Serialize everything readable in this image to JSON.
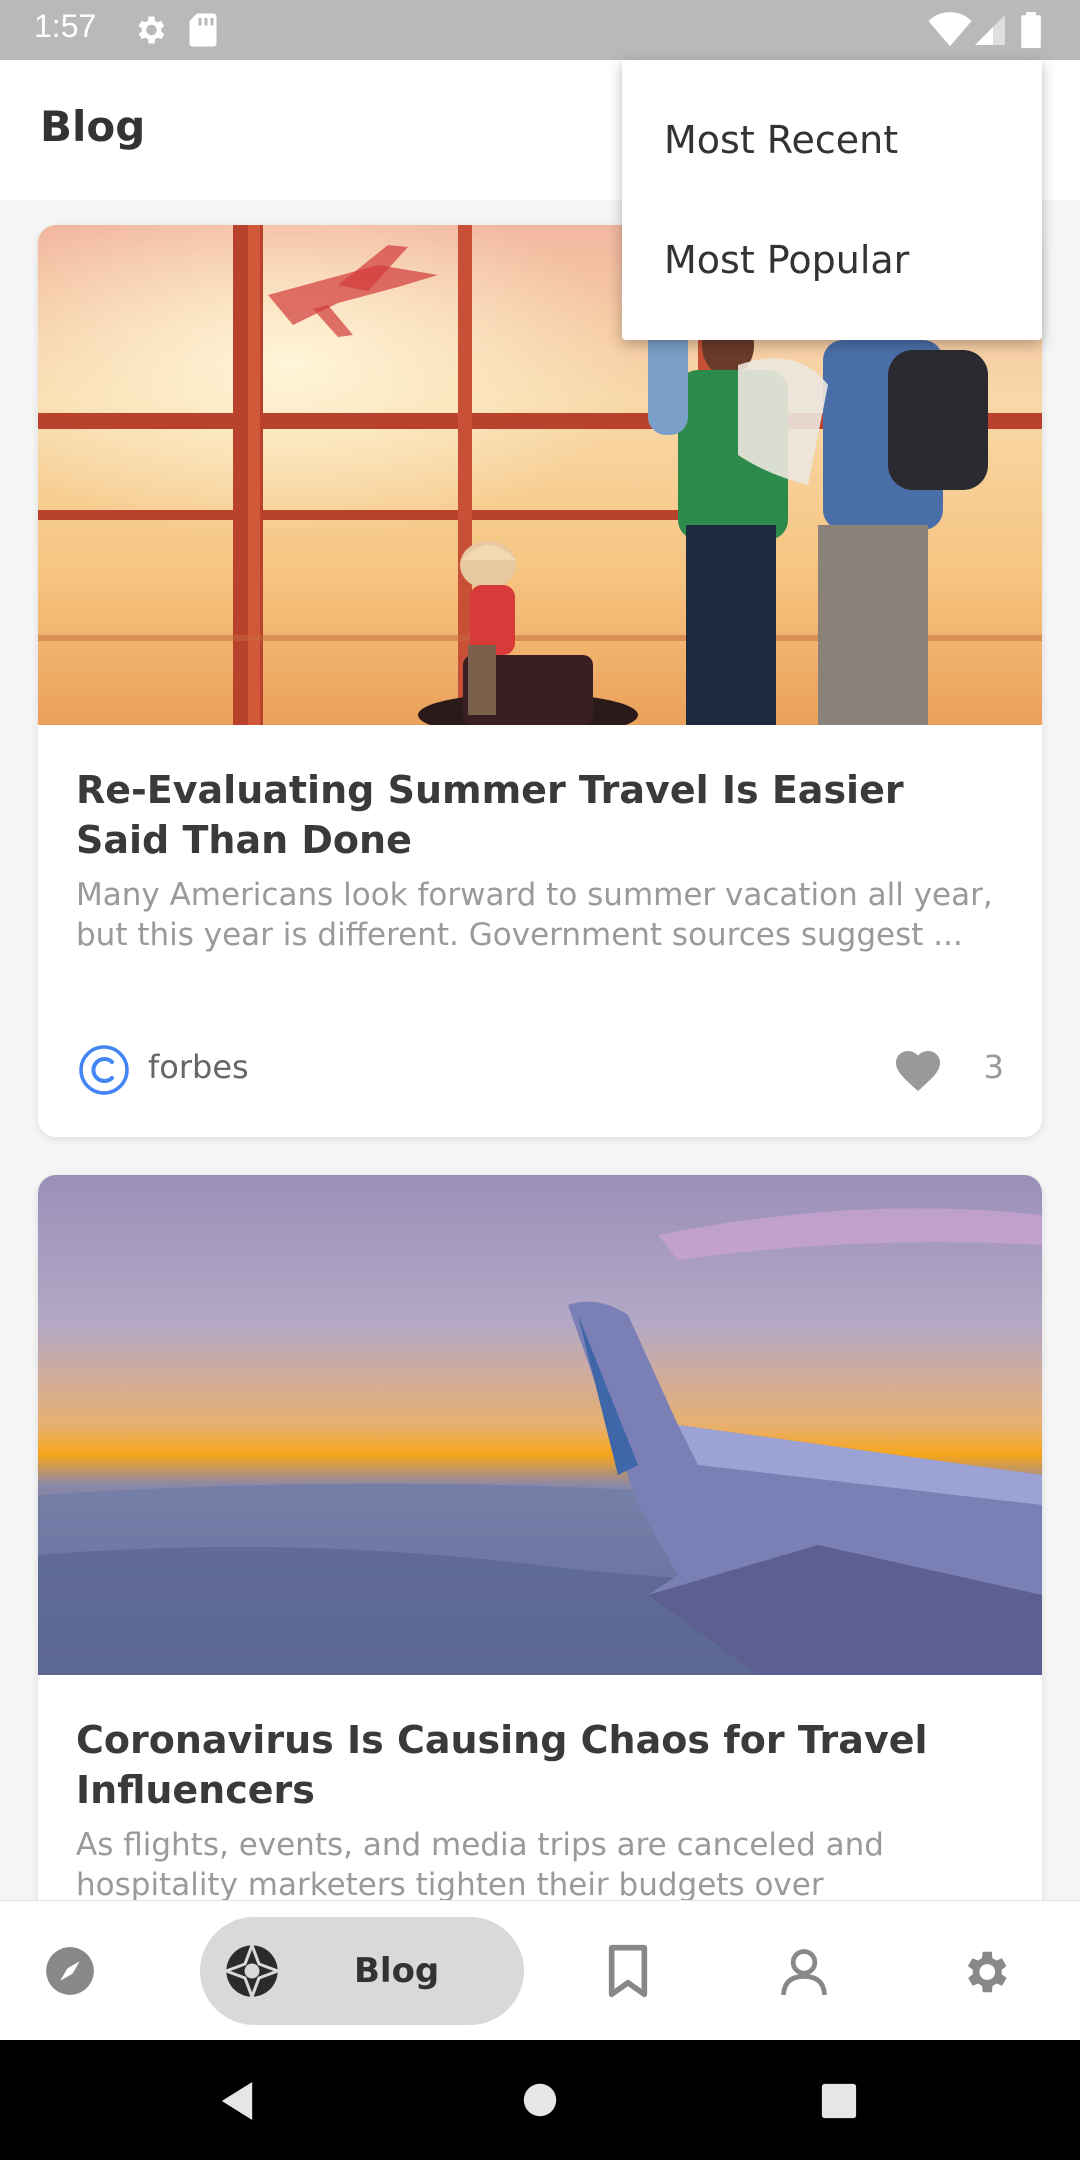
{
  "status": {
    "time": "1:57"
  },
  "header": {
    "title": "Blog"
  },
  "sort_menu": {
    "items": [
      "Most Recent",
      "Most Popular"
    ]
  },
  "posts": [
    {
      "title": "Re-Evaluating Summer Travel Is Easier Said Than Done",
      "excerpt": "Many Americans look forward to summer vacation all year, but this year is different. Government sources suggest ...",
      "source": "forbes",
      "likes": "3",
      "source_icon": "copyright-c-icon"
    },
    {
      "title": "Coronavirus Is Causing Chaos for Travel Influencers",
      "excerpt": "As flights, events, and media trips are canceled and hospitality marketers tighten their budgets over coronavirus..."
    }
  ],
  "bottom_nav": {
    "items": [
      "compass-icon",
      "camera-aperture-icon",
      "bookmark-icon",
      "person-icon",
      "gear-icon"
    ],
    "active_label": "Blog"
  },
  "colors": {
    "accent": "#4285f4",
    "pill": "#d9d9d9"
  }
}
